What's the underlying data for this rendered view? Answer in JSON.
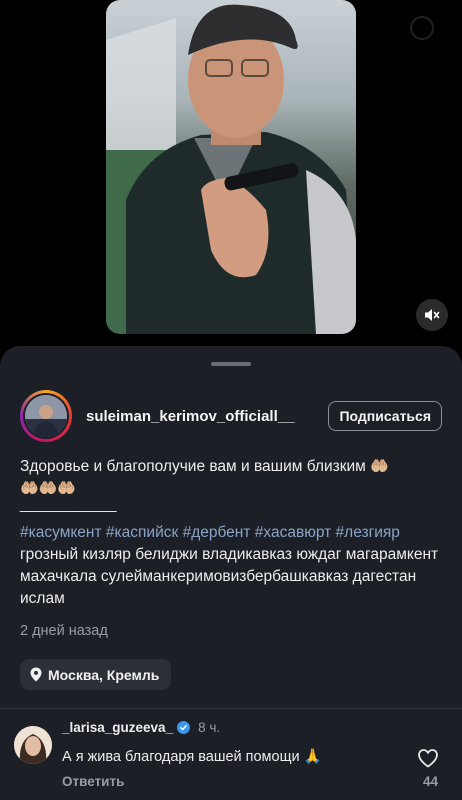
{
  "post": {
    "username": "suleiman_kerimov_officiall__",
    "follow_label": "Подписаться",
    "caption": "Здоровье и благополучие вам и вашим близким",
    "caption_emoji": "🤲🏼",
    "caption_emoji_row2": "🤲🏼🤲🏼🤲🏼",
    "divider": "_____________",
    "hashtags": [
      "#касумкент",
      "#каспийск",
      "#дербент",
      "#хасавюрт",
      "#лезгияр"
    ],
    "tags_tail": "грозный кизляр белиджи владикавказ юждаг магарамкент махачкала сулейманкеримовизбербашкавказ дагестан ислам",
    "time_ago": "2 дней назад",
    "location": "Москва, Кремль"
  },
  "video": {
    "mute_icon": "speaker-muted-icon"
  },
  "comment": {
    "username": "_larisa_guzeeva_",
    "verified_icon": "verified-badge-icon",
    "time_ago": "8 ч.",
    "text": "А я жива благодаря вашей помощи",
    "text_emoji": "🙏",
    "reply_label": "Ответить",
    "like_count": "44"
  },
  "colors": {
    "sheet_bg": "#1c1f26",
    "hashtag": "#8aa3c7",
    "verified": "#3897f0"
  }
}
